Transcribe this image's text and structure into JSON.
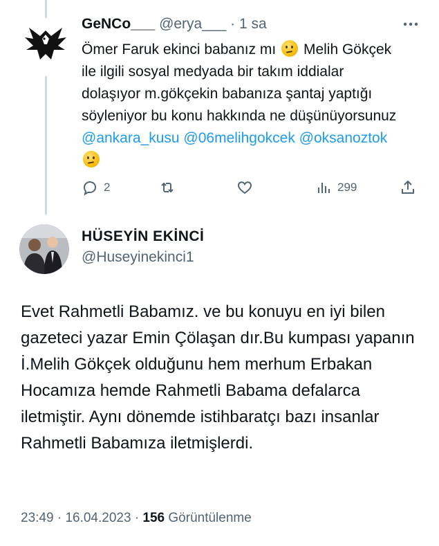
{
  "reply_tweet": {
    "display_name": "GeNCo___",
    "handle": "@erya___",
    "separator": "·",
    "time": "1 sa",
    "text_part1": "Ömer Faruk ekinci babanız mı",
    "text_part2": "Melih Gökçek ile ilgili sosyal medyada bir takım iddialar dolaşıyor m.gökçekin babanıza şantaj yaptığı söyleniyor bu konu hakkında ne düşünüyorsunuz",
    "mention1": "@ankara_kusu",
    "mention2": "@06melihgokcek",
    "mention3": "@oksanoztok",
    "emoji": "thinking-face",
    "actions": {
      "reply_count": "2",
      "retweet_count": "",
      "like_count": "",
      "views_count": "299"
    }
  },
  "main_tweet": {
    "display_name": "HÜSEYİN EKİNCİ",
    "handle": "@Huseyinekinci1",
    "text": "Evet Rahmetli Babamız. ve bu konuyu en iyi bilen  gazeteci yazar Emin Çölaşan dır.Bu kumpası yapanın İ.Melih Gökçek olduğunu hem merhum Erbakan Hocamıza hemde Rahmetli Babama defalarca iletmiştir. Aynı dönemde istihbaratçı bazı insanlar Rahmetli Babamıza iletmişlerdi.",
    "time": "23:49",
    "date": "16.04.2023",
    "separator": "·",
    "views_count": "156",
    "views_label": "Görüntülenme"
  },
  "colors": {
    "text": "#0f1419",
    "secondary": "#536471",
    "link": "#1d9bf0",
    "thread_line": "#cfd9de"
  }
}
